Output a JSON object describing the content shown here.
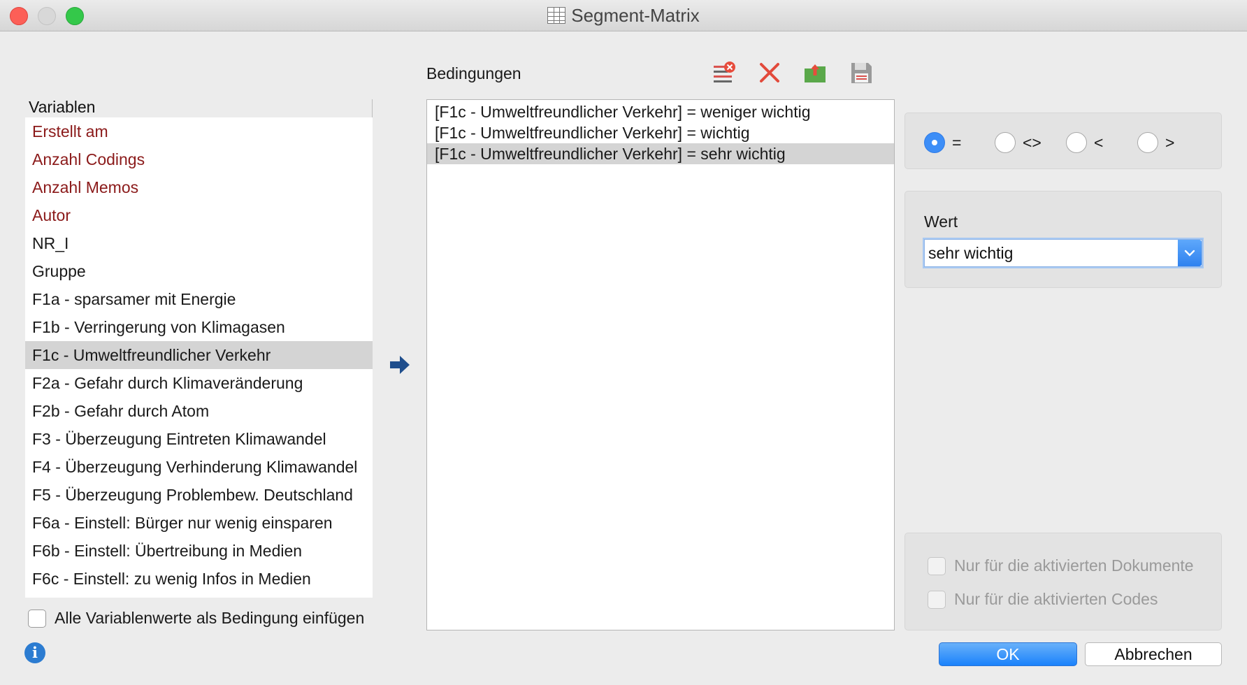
{
  "window": {
    "title": "Segment-Matrix"
  },
  "variables": {
    "header": "Variablen",
    "items": [
      {
        "label": "Erstellt am",
        "system": true
      },
      {
        "label": "Anzahl Codings",
        "system": true
      },
      {
        "label": "Anzahl Memos",
        "system": true
      },
      {
        "label": "Autor",
        "system": true
      },
      {
        "label": "NR_I",
        "system": false
      },
      {
        "label": "Gruppe",
        "system": false
      },
      {
        "label": "F1a - sparsamer mit Energie",
        "system": false
      },
      {
        "label": "F1b - Verringerung von Klimagasen",
        "system": false
      },
      {
        "label": "F1c - Umweltfreundlicher Verkehr",
        "system": false,
        "selected": true
      },
      {
        "label": "F2a - Gefahr durch Klimaveränderung",
        "system": false
      },
      {
        "label": "F2b - Gefahr durch Atom",
        "system": false
      },
      {
        "label": "F3 - Überzeugung Eintreten Klimawandel",
        "system": false
      },
      {
        "label": "F4 - Überzeugung Verhinderung Klimawandel",
        "system": false
      },
      {
        "label": "F5 - Überzeugung Problembew. Deutschland",
        "system": false
      },
      {
        "label": "F6a - Einstell: Bürger nur wenig einsparen",
        "system": false
      },
      {
        "label": "F6b - Einstell: Übertreibung in Medien",
        "system": false
      },
      {
        "label": "F6c - Einstell: zu wenig Infos in Medien",
        "system": false
      }
    ],
    "all_values_checkbox": {
      "label": "Alle Variablenwerte als Bedingung einfügen",
      "checked": false
    }
  },
  "conditions": {
    "label": "Bedingungen",
    "toolbar": [
      "clear-list-icon",
      "delete-icon",
      "export-icon",
      "save-icon"
    ],
    "rows": [
      {
        "text": "[F1c - Umweltfreundlicher Verkehr] = weniger wichtig",
        "selected": false
      },
      {
        "text": "[F1c - Umweltfreundlicher Verkehr] = wichtig",
        "selected": false
      },
      {
        "text": "[F1c - Umweltfreundlicher Verkehr] = sehr wichtig",
        "selected": true
      }
    ]
  },
  "operators": {
    "options": [
      {
        "label": "=",
        "selected": true
      },
      {
        "label": "<>",
        "selected": false
      },
      {
        "label": "<",
        "selected": false
      },
      {
        "label": ">",
        "selected": false
      }
    ]
  },
  "wert": {
    "label": "Wert",
    "value": "sehr wichtig"
  },
  "scope": {
    "docs_label": "Nur für die aktivierten Dokumente",
    "codes_label": "Nur für die aktivierten Codes",
    "docs_checked": false,
    "codes_checked": false,
    "enabled": false
  },
  "buttons": {
    "ok": "OK",
    "cancel": "Abbrechen"
  },
  "colors": {
    "system_variable": "#8b1a1a",
    "accent": "#1a82fb",
    "selection": "#d4d4d4"
  }
}
